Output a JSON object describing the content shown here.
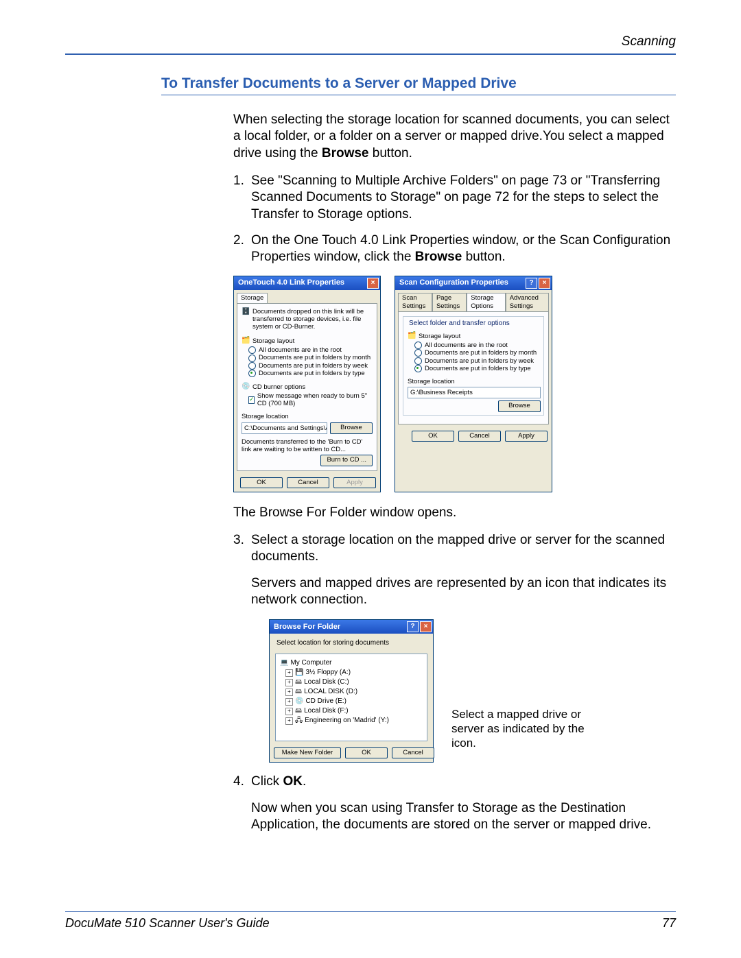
{
  "header": {
    "section_label": "Scanning"
  },
  "title": "To Transfer Documents to a Server or Mapped Drive",
  "para_intro_a": "When selecting the storage location for scanned documents, you can select a local folder, or a folder on a server or mapped drive.You select a mapped drive using the ",
  "para_intro_bold": "Browse",
  "para_intro_b": " button.",
  "steps": {
    "s1": {
      "num": "1.",
      "txt": "See \"Scanning to Multiple Archive Folders\" on page 73 or \"Transferring Scanned Documents to Storage\" on page 72 for the steps to select the Transfer to Storage options."
    },
    "s2": {
      "num": "2.",
      "txt_a": "On the One Touch 4.0 Link Properties window, or the Scan Configuration Properties window, click the ",
      "txt_bold": "Browse",
      "txt_b": " button."
    },
    "s3": {
      "num": "3.",
      "txt": "Select a storage location on the mapped drive or server for the scanned documents."
    },
    "s4": {
      "num": "4.",
      "txt_a": "Click ",
      "txt_bold": "OK",
      "txt_b": "."
    }
  },
  "after_figs_1": "The Browse For Folder window opens.",
  "after_s3": "Servers and mapped drives are represented by an icon that indicates its network connection.",
  "callout": "Select a mapped drive or server as indicated by the icon.",
  "after_s4": "Now when you scan using Transfer to Storage as the Destination Application, the documents are stored on the server or mapped drive.",
  "dlg1": {
    "title": "OneTouch 4.0 Link Properties",
    "tab": "Storage",
    "desc": "Documents dropped on this link will be transferred to storage devices, i.e. file system or CD-Burner.",
    "layout_label": "Storage layout",
    "r1": "All documents are in the root",
    "r2": "Documents are put in folders by month",
    "r3": "Documents are put in folders by week",
    "r4": "Documents are put in folders by type",
    "cd_label": "CD burner options",
    "cd_opt": "Show message when ready to burn 5'' CD (700 MB)",
    "loc_label": "Storage location",
    "loc_value": "C:\\Documents and Settings\\Administrator\\My Do",
    "browse": "Browse",
    "transfer_note": "Documents transferred to the 'Burn to CD' link are waiting to be written to CD...",
    "burn": "Burn to CD ...",
    "ok": "OK",
    "cancel": "Cancel",
    "apply": "Apply"
  },
  "dlg2": {
    "title": "Scan Configuration Properties",
    "tabs": {
      "t1": "Scan Settings",
      "t2": "Page Settings",
      "t3": "Storage Options",
      "t4": "Advanced Settings"
    },
    "group": "Select folder and transfer options",
    "layout_label": "Storage layout",
    "r1": "All documents are in the root",
    "r2": "Documents are put in folders by month",
    "r3": "Documents are put in folders by week",
    "r4": "Documents are put in folders by type",
    "loc_label": "Storage location",
    "loc_value": "G:\\Business Receipts",
    "browse": "Browse",
    "ok": "OK",
    "cancel": "Cancel",
    "apply": "Apply"
  },
  "dlg3": {
    "title": "Browse For Folder",
    "prompt": "Select location for storing documents",
    "items": {
      "root": "My Computer",
      "a": "3½ Floppy (A:)",
      "c": "Local Disk (C:)",
      "d": "LOCAL DISK (D:)",
      "e": "CD Drive (E:)",
      "f": "Local Disk (F:)",
      "y": "Engineering on 'Madrid' (Y:)"
    },
    "make": "Make New Folder",
    "ok": "OK",
    "cancel": "Cancel"
  },
  "footer": {
    "left": "DocuMate 510 Scanner User's Guide",
    "right": "77"
  }
}
